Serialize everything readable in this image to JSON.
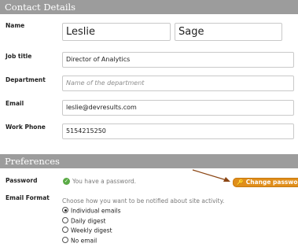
{
  "contact_section": {
    "title": "Contact Details"
  },
  "name": {
    "label": "Name",
    "first_name": "Leslie",
    "last_name": "Sage"
  },
  "job_title": {
    "label": "Job title",
    "value": "Director of Analytics"
  },
  "department": {
    "label": "Department",
    "placeholder": "Name of the department"
  },
  "email": {
    "label": "Email",
    "value": "leslie@devresults.com"
  },
  "work_phone": {
    "label": "Work Phone",
    "value": "5154215250"
  },
  "preferences_section": {
    "title": "Preferences"
  },
  "password": {
    "label": "Password",
    "status": "You have a password.",
    "change_button": "Change password",
    "status_icon": "check-icon",
    "button_icon": "key-icon",
    "button_color": "#e08e1b",
    "arrow_color": "#8b4513"
  },
  "email_format": {
    "label": "Email Format",
    "description": "Choose how you want to be notified about site activity.",
    "options": [
      "Individual emails",
      "Daily digest",
      "Weekly digest",
      "No email"
    ],
    "selected": "Individual emails"
  }
}
